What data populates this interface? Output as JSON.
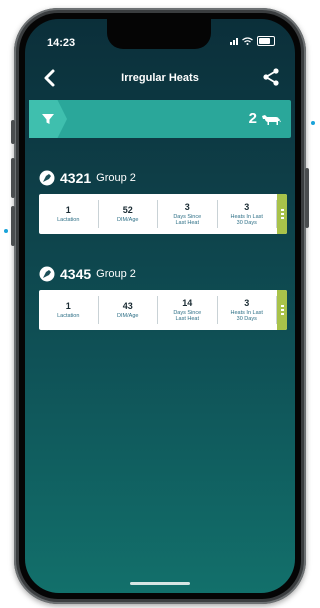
{
  "status_bar": {
    "time": "14:23"
  },
  "header": {
    "title": "Irregular Heats"
  },
  "filter_bar": {
    "count": "2"
  },
  "animals": [
    {
      "id": "4321",
      "group": "Group 2",
      "stats": [
        {
          "value": "1",
          "label": "Lactation"
        },
        {
          "value": "52",
          "label": "DIM/Age"
        },
        {
          "value": "3",
          "label": "Days Since Last Heat"
        },
        {
          "value": "3",
          "label": "Heats In Last 30 Days"
        }
      ]
    },
    {
      "id": "4345",
      "group": "Group 2",
      "stats": [
        {
          "value": "1",
          "label": "Lactation"
        },
        {
          "value": "43",
          "label": "DIM/Age"
        },
        {
          "value": "14",
          "label": "Days Since Last Heat"
        },
        {
          "value": "3",
          "label": "Heats In Last 30 Days"
        }
      ]
    }
  ],
  "colors": {
    "accent": "#2aa79a",
    "card_tab": "#a8c24a",
    "background_top": "#0b2f3a",
    "background_bottom": "#12706b"
  },
  "icons": {
    "back": "back-arrow-icon",
    "share": "share-icon",
    "filter": "filter-icon",
    "cow": "cow-icon",
    "animal": "animal-tag-icon"
  }
}
